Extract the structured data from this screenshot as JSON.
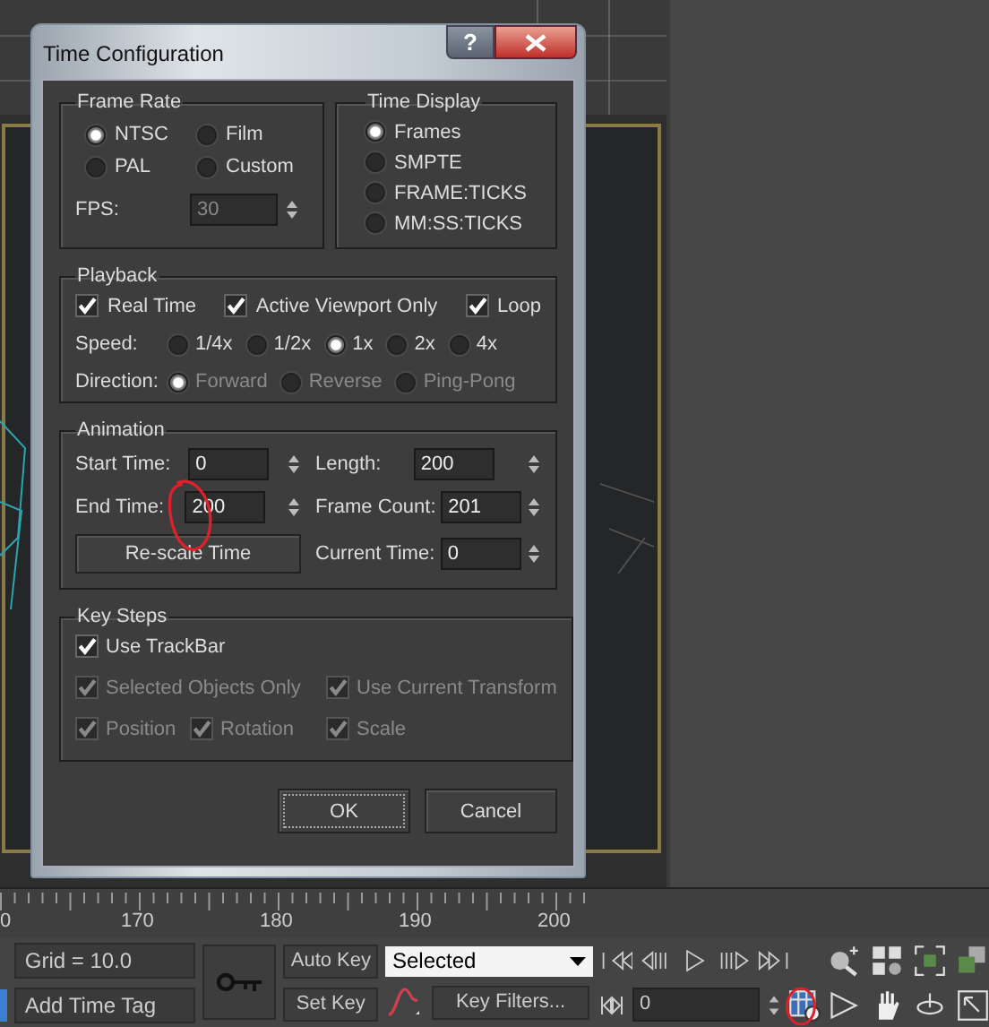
{
  "dialog": {
    "title": "Time Configuration",
    "help": "?",
    "frame_rate": {
      "title": "Frame Rate",
      "options": [
        {
          "label": "NTSC",
          "selected": true
        },
        {
          "label": "Film",
          "selected": false
        },
        {
          "label": "PAL",
          "selected": false
        },
        {
          "label": "Custom",
          "selected": false
        }
      ],
      "fps_label": "FPS:",
      "fps_value": "30",
      "fps_disabled": true
    },
    "time_display": {
      "title": "Time Display",
      "options": [
        {
          "label": "Frames",
          "selected": true
        },
        {
          "label": "SMPTE",
          "selected": false
        },
        {
          "label": "FRAME:TICKS",
          "selected": false
        },
        {
          "label": "MM:SS:TICKS",
          "selected": false
        }
      ]
    },
    "playback": {
      "title": "Playback",
      "checks": [
        {
          "label": "Real Time",
          "checked": true
        },
        {
          "label": "Active Viewport Only",
          "checked": true
        },
        {
          "label": "Loop",
          "checked": true
        }
      ],
      "speed_label": "Speed:",
      "speeds": [
        {
          "label": "1/4x",
          "selected": false
        },
        {
          "label": "1/2x",
          "selected": false
        },
        {
          "label": "1x",
          "selected": true
        },
        {
          "label": "2x",
          "selected": false
        },
        {
          "label": "4x",
          "selected": false
        }
      ],
      "direction_label": "Direction:",
      "directions": [
        {
          "label": "Forward",
          "selected": true,
          "disabled": true
        },
        {
          "label": "Reverse",
          "selected": false,
          "disabled": true
        },
        {
          "label": "Ping-Pong",
          "selected": false,
          "disabled": true
        }
      ]
    },
    "animation": {
      "title": "Animation",
      "fields": [
        {
          "label": "Start Time:",
          "value": "0"
        },
        {
          "label": "Length:",
          "value": "200"
        },
        {
          "label": "End Time:",
          "value": "200"
        },
        {
          "label": "Frame Count:",
          "value": "201"
        },
        {
          "label": "Current Time:",
          "value": "0"
        }
      ],
      "rescale_button": "Re-scale Time"
    },
    "key_steps": {
      "title": "Key Steps",
      "checks": [
        {
          "label": "Use TrackBar",
          "checked": true,
          "disabled": false
        },
        {
          "label": "Selected Objects Only",
          "checked": true,
          "disabled": true
        },
        {
          "label": "Use Current Transform",
          "checked": true,
          "disabled": true
        },
        {
          "label": "Position",
          "checked": true,
          "disabled": true
        },
        {
          "label": "Rotation",
          "checked": true,
          "disabled": true
        },
        {
          "label": "Scale",
          "checked": true,
          "disabled": true
        }
      ]
    },
    "buttons": [
      {
        "label": "OK",
        "focused": true
      },
      {
        "label": "Cancel",
        "focused": false
      }
    ]
  },
  "ruler": {
    "labels": [
      "0",
      "170",
      "180",
      "190",
      "200"
    ]
  },
  "toolbar": {
    "grid_status": "Grid = 10.0",
    "add_time_tag": "Add Time Tag",
    "auto_key": "Auto Key",
    "set_key": "Set Key",
    "key_set": "Selected",
    "key_filters": "Key Filters...",
    "current_frame": "0"
  }
}
